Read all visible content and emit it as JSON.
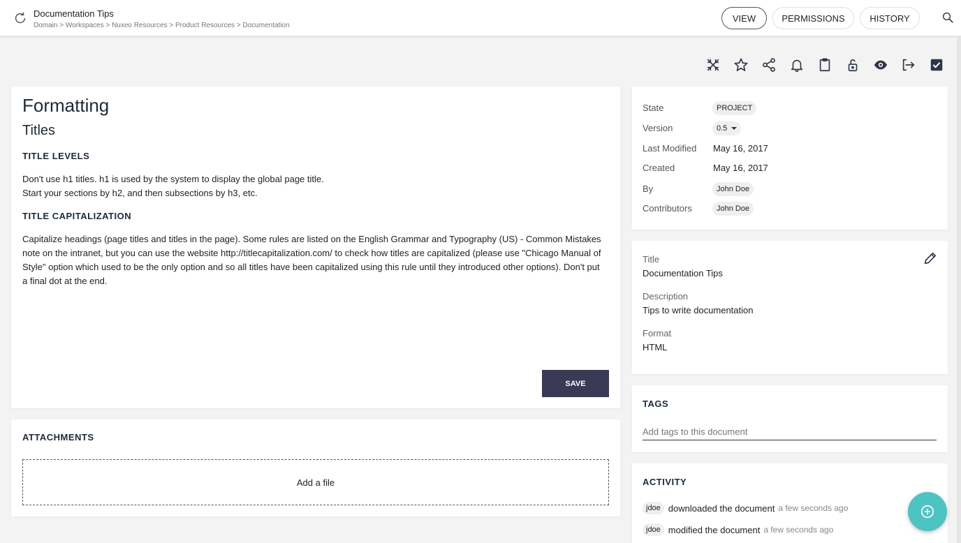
{
  "header": {
    "doc_title": "Documentation Tips",
    "breadcrumb": "Domain > Workspaces > Nuxeo Resources > Product Resources > Documentation",
    "tabs": [
      "VIEW",
      "PERMISSIONS",
      "HISTORY"
    ]
  },
  "actions": [
    "collapse-icon",
    "star-icon",
    "share-icon",
    "bell-icon",
    "clipboard-icon",
    "unlock-icon",
    "eye-icon",
    "export-icon",
    "checkbox-icon"
  ],
  "content": {
    "heading": "Formatting",
    "subheading": "Titles",
    "section1_title": "TITLE LEVELS",
    "section1_line1": "Don't use h1 titles. h1 is used by the system to display the global page title.",
    "section1_line2": "Start your sections by h2, and then subsections by h3, etc.",
    "section2_title": "TITLE CAPITALIZATION",
    "section2_text": "Capitalize headings (page titles and titles in the page). Some rules are listed on the English Grammar and Typography (US) - Common Mistakes note on the intranet, but you can use the website http://titlecapitalization.com/ to check how titles are capitalized (please use \"Chicago Manual of Style\" option which used to be the only option and so all titles have been capitalized using this rule until they introduced other options). Don't put a final dot at the end.",
    "save_label": "SAVE"
  },
  "attachments": {
    "title": "ATTACHMENTS",
    "dropzone": "Add a file"
  },
  "metadata": {
    "state_label": "State",
    "state_value": "PROJECT",
    "version_label": "Version",
    "version_value": "0.5",
    "modified_label": "Last Modified",
    "modified_value": "May 16, 2017",
    "created_label": "Created",
    "created_value": "May 16, 2017",
    "by_label": "By",
    "by_value": "John Doe",
    "contributors_label": "Contributors",
    "contributors_value": "John Doe"
  },
  "info": {
    "title_label": "Title",
    "title_value": "Documentation Tips",
    "description_label": "Description",
    "description_value": "Tips to write documentation",
    "format_label": "Format",
    "format_value": "HTML"
  },
  "tags": {
    "title": "TAGS",
    "placeholder": "Add tags to this document"
  },
  "activity": {
    "title": "ACTIVITY",
    "items": [
      {
        "user": "jdoe",
        "action": "downloaded the document",
        "time": "a few seconds ago"
      },
      {
        "user": "jdoe",
        "action": "modified the document",
        "time": "a few seconds ago"
      }
    ]
  }
}
